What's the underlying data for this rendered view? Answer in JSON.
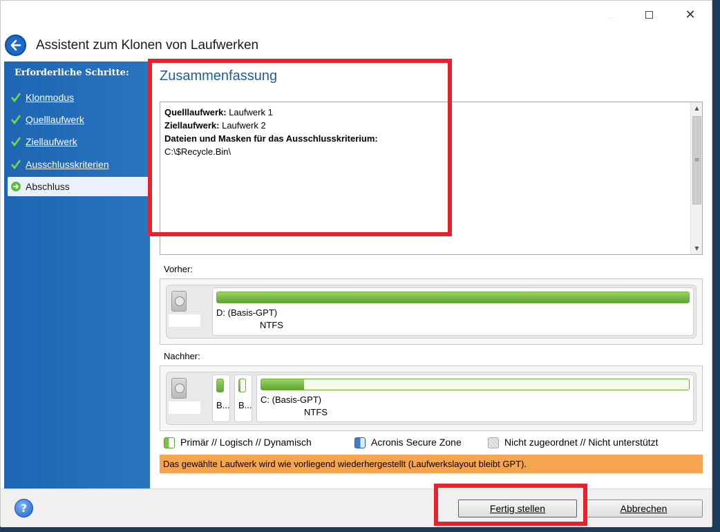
{
  "window": {
    "title": "Assistent zum Klonen von Laufwerken",
    "controls": {
      "minimize": "—",
      "maximize": "☐",
      "close": "✕"
    }
  },
  "sidebar": {
    "heading": "Erforderliche Schritte:",
    "steps": [
      {
        "label": "Klonmodus",
        "state": "done"
      },
      {
        "label": "Quelllaufwerk",
        "state": "done"
      },
      {
        "label": "Ziellaufwerk",
        "state": "done"
      },
      {
        "label": "Ausschlusskriterien",
        "state": "done"
      },
      {
        "label": "Abschluss",
        "state": "current"
      }
    ]
  },
  "main": {
    "section_title": "Zusammenfassung",
    "summary": {
      "source_label": "Quelllaufwerk:",
      "source_value": "Laufwerk 1",
      "target_label": "Ziellaufwerk:",
      "target_value": "Laufwerk 2",
      "exclusions_label": "Dateien und Masken für das Ausschlusskriterium:",
      "exclusions_value": "C:\\$Recycle.Bin\\"
    },
    "before": {
      "label": "Vorher:",
      "partitions": [
        {
          "label": "D: (Basis-GPT)",
          "fs": "NTFS",
          "used_fraction": 1.0
        }
      ]
    },
    "after": {
      "label": "Nachher:",
      "partitions": [
        {
          "label": "B...",
          "used_fraction": 1.0
        },
        {
          "label": "B...",
          "used_fraction": 0.2
        },
        {
          "label": "C: (Basis-GPT)",
          "fs": "NTFS",
          "used_fraction": 0.1
        }
      ]
    },
    "legend": {
      "primary": "Primär // Logisch // Dynamisch",
      "secure_zone": "Acronis Secure Zone",
      "unallocated": "Nicht zugeordnet // Nicht unterstützt"
    },
    "status_message": "Das gewählte Laufwerk wird wie vorliegend wiederhergestellt (Laufwerkslayout bleibt GPT)."
  },
  "footer": {
    "help": "?",
    "finish_label": "Fertig stellen",
    "cancel_label": "Abbrechen"
  },
  "colors": {
    "sidebar_bg": "#1e66b3",
    "accent_title": "#1f5ca8",
    "status_bg": "#f5a54f",
    "highlight": "#e8212c",
    "usage_green": "#7cc24a"
  }
}
